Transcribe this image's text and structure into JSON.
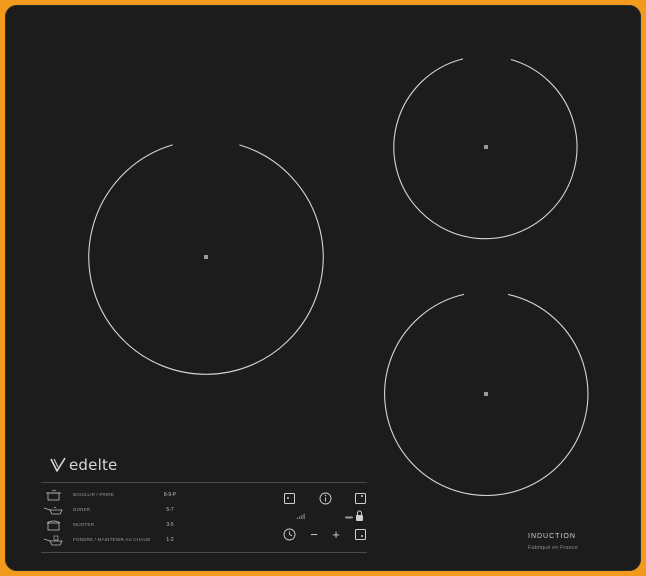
{
  "brand": {
    "name": "edelte",
    "logo_icon": "v-check-logo-icon"
  },
  "zones": [
    {
      "name": "front-left-zone"
    },
    {
      "name": "rear-right-zone"
    },
    {
      "name": "front-right-zone"
    }
  ],
  "guide": [
    {
      "icon": "boil-pot-icon",
      "label": "BOUILLIR / FRIRE",
      "level": "8-9-P"
    },
    {
      "icon": "pan-icon",
      "label": "DORER",
      "level": "5-7"
    },
    {
      "icon": "simmer-pot-icon",
      "label": "MIJOTER",
      "level": "3-5"
    },
    {
      "icon": "melt-pan-icon",
      "label": "FONDRE / MAINTENIR AU CHAUD",
      "level": "1-2"
    }
  ],
  "controls": {
    "power_icon": "power-level-icon",
    "info_icon": "info-icon",
    "timer_icon": "timer-icon",
    "minus_icon": "minus-icon",
    "plus_icon": "plus-icon",
    "lock_icon": "lock-icon",
    "minus_symbol": "−",
    "plus_symbol": "+",
    "info_symbol": "i"
  },
  "footer": {
    "technology": "INDUCTION",
    "origin": "Fabriqué en France"
  },
  "colors": {
    "frame": "#f29a1c",
    "glass": "#1c1c1c",
    "marking": "#d8d8d8"
  }
}
